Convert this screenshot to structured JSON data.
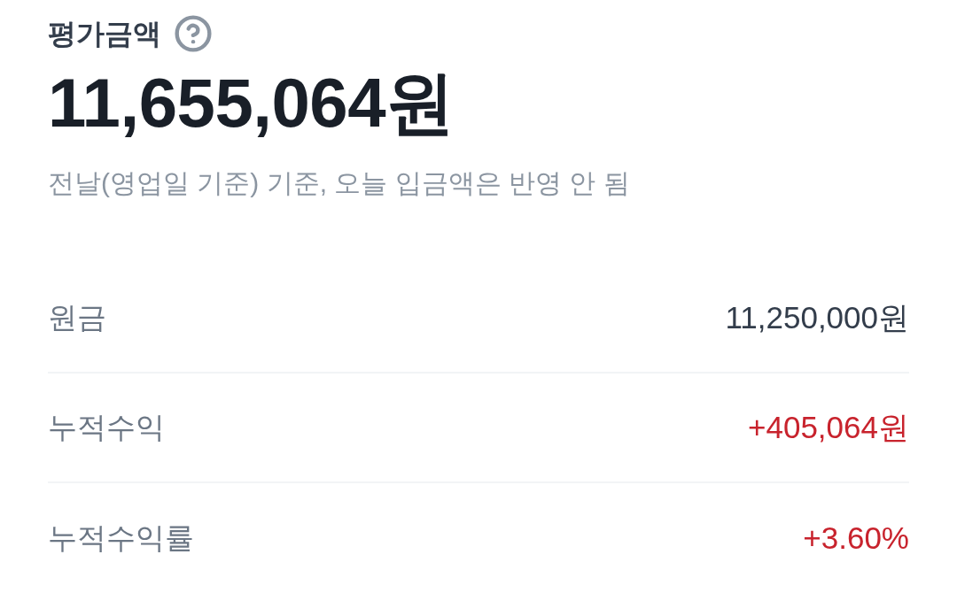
{
  "header": {
    "title": "평가금액",
    "amount": "11,655,064원",
    "note": "전날(영업일 기준) 기준, 오늘 입금액은 반영 안 됨"
  },
  "rows": [
    {
      "label": "원금",
      "value": "11,250,000원",
      "color": "#333d4b"
    },
    {
      "label": "누적수익",
      "value": "+405,064원",
      "color": "#c8232d"
    },
    {
      "label": "누적수익률",
      "value": "+3.60%",
      "color": "#c8232d"
    }
  ]
}
